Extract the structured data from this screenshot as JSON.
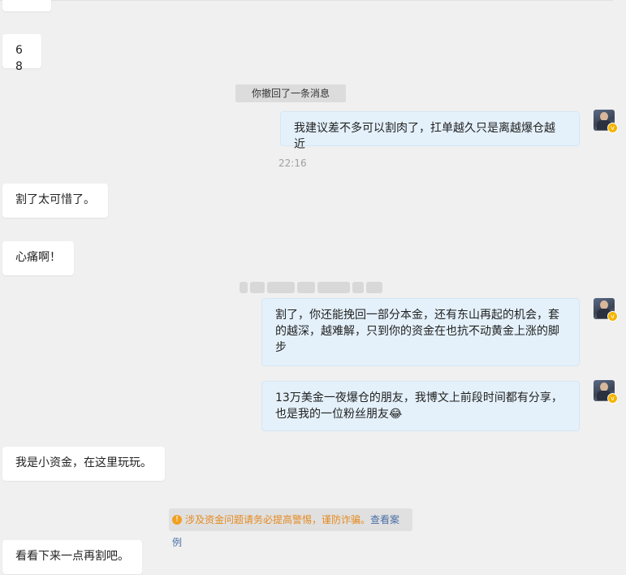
{
  "messages": {
    "m0": "",
    "m1": "68",
    "recall_notice": "你撤回了一条消息",
    "m2": "我建议差不多可以割肉了，扛单越久只是离越爆仓越近",
    "time1": "22:16",
    "m3": "割了太可惜了。",
    "m4": "心痛啊！",
    "m5": "割了，你还能挽回一部分本金，还有东山再起的机会，套的越深，越难解，只到你的资金在也抗不动黄金上涨的脚步",
    "m6": "13万美金一夜爆仓的朋友，我博文上前段时间都有分享，也是我的一位粉丝朋友",
    "m6_emoji": "😂",
    "m7": "我是小资金，在这里玩玩。",
    "m8": "看看下来一点再割吧。"
  },
  "warning": {
    "icon": "warning-icon",
    "text": "涉及资金问题请务必提高警惕，谨防诈骗。",
    "link": "查看案例"
  },
  "colors": {
    "left_bubble": "#ffffff",
    "right_bubble": "#e4f1fb",
    "background": "#f0f0f0",
    "warning_text": "#e58a1f",
    "link": "#4a6fa5"
  }
}
